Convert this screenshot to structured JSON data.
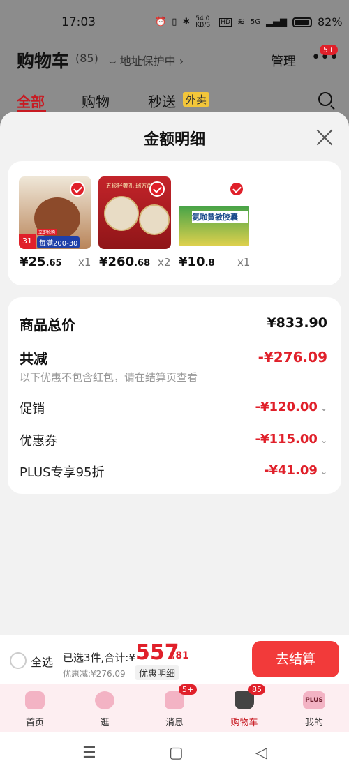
{
  "status": {
    "time": "17:03",
    "net_speed": "54.0 KB/S",
    "hd": "HD",
    "signal": "5G",
    "battery_pct": "82%"
  },
  "cart": {
    "title": "购物车",
    "count": "(85)",
    "address": "地址保护中",
    "manage": "管理",
    "more_badge": "5+"
  },
  "tabs": [
    {
      "label": "全部",
      "active": true
    },
    {
      "label": "购物"
    },
    {
      "label": "秒送",
      "tag": "外卖"
    }
  ],
  "sheet": {
    "title": "金额明细"
  },
  "products": [
    {
      "icon": "dried-mushroom-jar-image",
      "price_int": "¥25",
      "price_dec": ".65",
      "qty": "x1",
      "badge": "31",
      "promo": "每满200-30",
      "promo_small": "立即抢购"
    },
    {
      "icon": "tea-gift-box-image",
      "price_int": "¥260",
      "price_dec": ".68",
      "qty": "x2",
      "box_text": "五珍轻奢礼 瑞方尚礼盒"
    },
    {
      "icon": "medicine-box-image",
      "price_int": "¥10",
      "price_dec": ".8",
      "qty": "x1",
      "box_text": "氨咖黄敏胶囊"
    }
  ],
  "summary": {
    "total_label": "商品总价",
    "total_value": "¥833.90",
    "reduce_label": "共减",
    "reduce_value": "-¥276.09",
    "hint": "以下优惠不包含红包，请在结算页查看",
    "rows": [
      {
        "label": "促销",
        "value": "-¥120.00"
      },
      {
        "label": "优惠券",
        "value": "-¥115.00"
      },
      {
        "label": "PLUS专享95折",
        "value": "-¥41.09"
      }
    ]
  },
  "checkout": {
    "select_all": "全选",
    "selected_text": "已选3件,合计:¥",
    "total_int": "557",
    "total_dec": ".81",
    "discount_text": "优惠减:¥276.09",
    "detail_button": "优惠明细",
    "pay_button": "去结算"
  },
  "nav": [
    {
      "label": "首页",
      "icon": "home-icon"
    },
    {
      "label": "逛",
      "icon": "browse-icon"
    },
    {
      "label": "消息",
      "icon": "message-icon",
      "badge": "5+"
    },
    {
      "label": "购物车",
      "icon": "cart-icon",
      "badge": "85",
      "active": true
    },
    {
      "label": "我的",
      "icon": "plus-member-icon",
      "icon_text": "PLUS"
    }
  ],
  "colors": {
    "accent": "#e0202a",
    "button": "#f23a3a",
    "nav_bg": "#fdeef1"
  }
}
